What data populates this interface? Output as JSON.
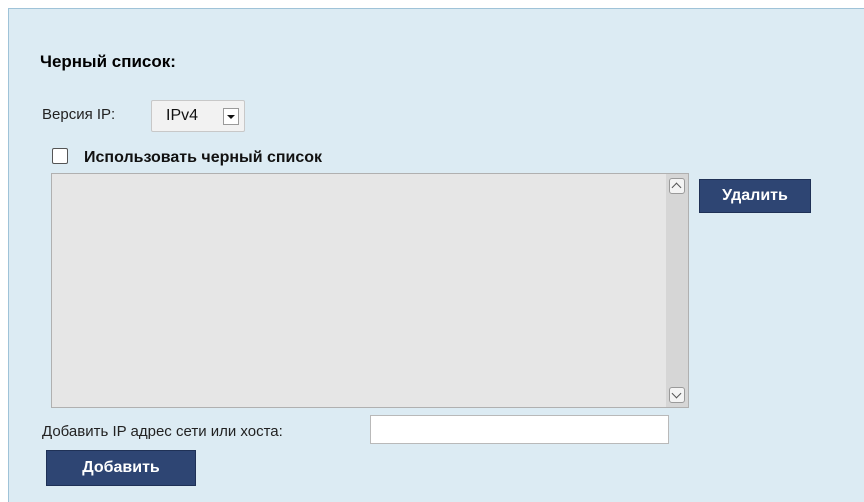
{
  "blacklist": {
    "title": "Черный список:",
    "ip_version_label": "Версия IP:",
    "ip_version_value": "IPv4",
    "use_checkbox_label": "Использовать черный список",
    "use_checked": false,
    "delete_button": "Удалить",
    "add_label": "Добавить IP адрес сети или хоста:",
    "add_input_value": "",
    "add_button": "Добавить"
  },
  "icons": {
    "select_arrow": "chevron-down-icon",
    "scroll_up": "chevron-up-icon",
    "scroll_down": "chevron-down-icon"
  },
  "colors": {
    "panel_background": "#dcebf3",
    "button_background": "#2e4573",
    "listbox_background": "#e6e6e6"
  }
}
